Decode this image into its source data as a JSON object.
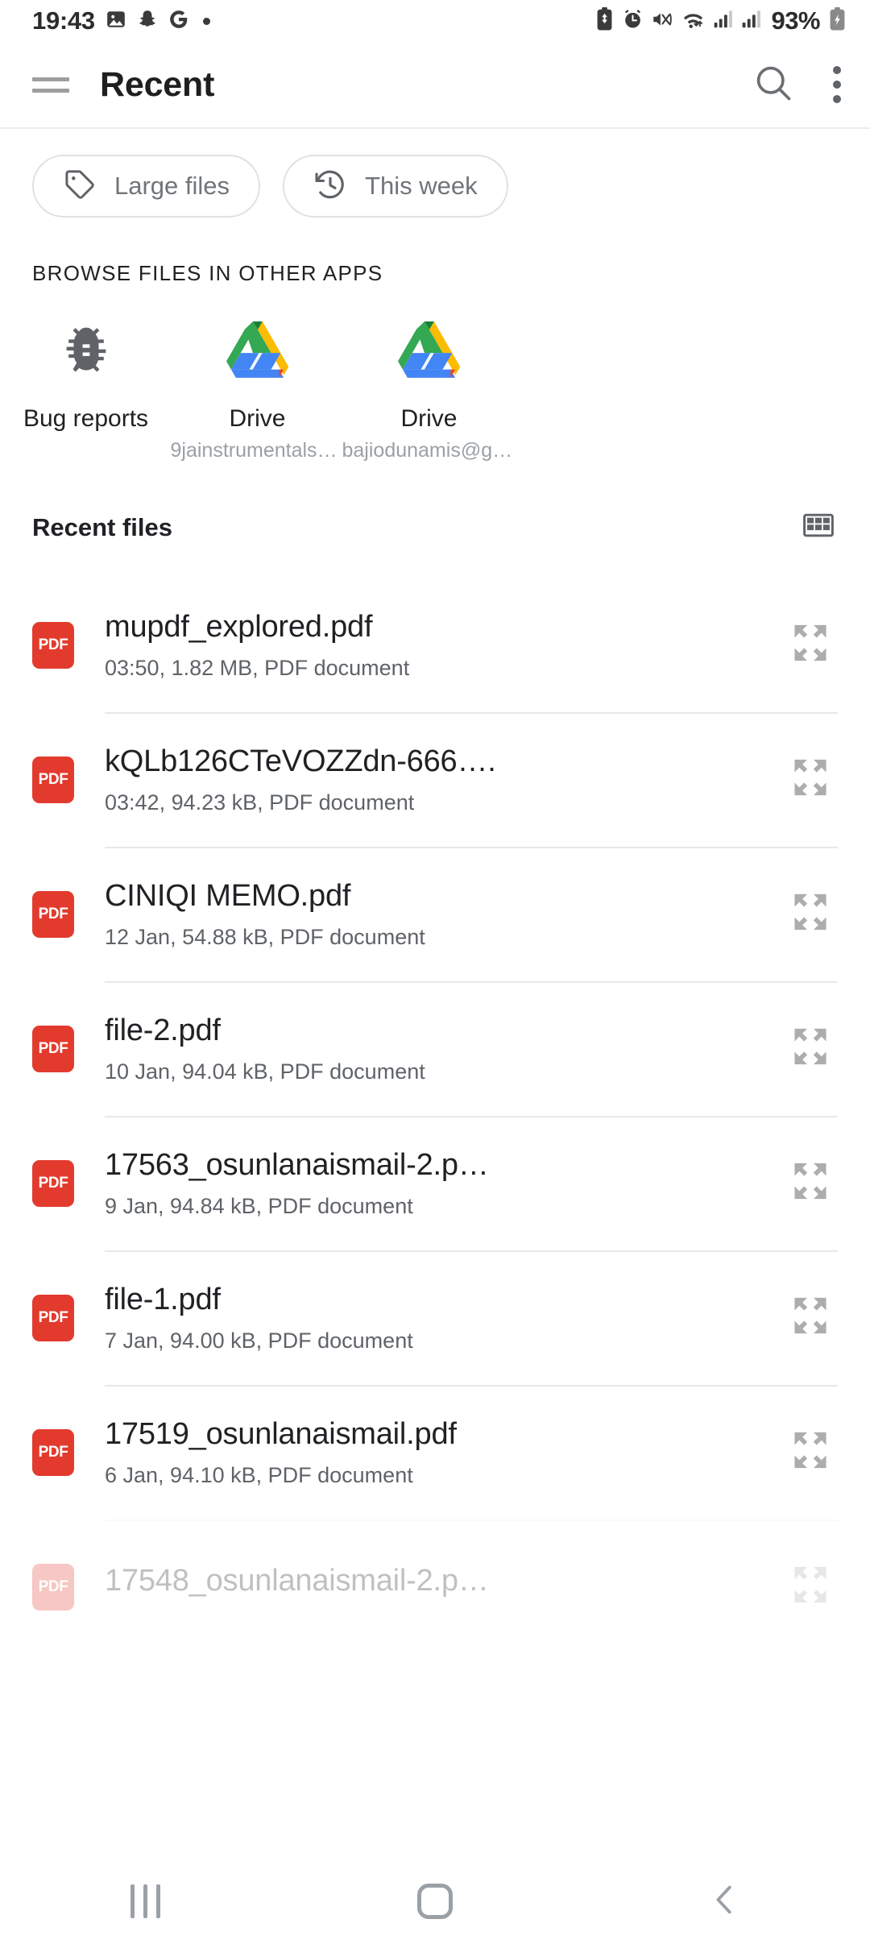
{
  "status_bar": {
    "time": "19:43",
    "battery_percent": "93%",
    "left_icons": [
      "photos-icon",
      "snapchat-icon",
      "google-icon",
      "dot-indicator-icon"
    ],
    "right_icons": [
      "battery-saver-icon",
      "alarm-icon",
      "mute-vibrate-icon",
      "wifi-icon",
      "signal-sim1-icon",
      "signal-sim2-icon",
      "battery-charging-icon"
    ]
  },
  "app_bar": {
    "title": "Recent",
    "menu_icon": "hamburger-menu-icon",
    "search_icon": "search-icon",
    "overflow_icon": "kebab-menu-icon"
  },
  "chips": [
    {
      "label": "Large files",
      "icon": "tag-icon"
    },
    {
      "label": "This week",
      "icon": "history-clock-icon"
    }
  ],
  "browse_section": {
    "heading": "BROWSE FILES IN OTHER APPS",
    "apps": [
      {
        "name": "Bug reports",
        "subtitle": "",
        "icon": "bug-icon"
      },
      {
        "name": "Drive",
        "subtitle": "9jainstrumentals@…",
        "icon": "google-drive-icon"
      },
      {
        "name": "Drive",
        "subtitle": "bajiodunamis@gm…",
        "icon": "google-drive-icon"
      }
    ]
  },
  "recent_files": {
    "heading": "Recent files",
    "view_toggle_icon": "grid-view-icon",
    "row_action_icon": "expand-arrows-icon",
    "file_type_badge": "PDF",
    "items": [
      {
        "name": "mupdf_explored.pdf",
        "meta": "03:50, 1.82 MB, PDF document"
      },
      {
        "name": "kQLb126CTeVOZZdn-666….",
        "meta": "03:42, 94.23 kB, PDF document"
      },
      {
        "name": "CINIQI MEMO.pdf",
        "meta": "12 Jan, 54.88 kB, PDF document"
      },
      {
        "name": "file-2.pdf",
        "meta": "10 Jan, 94.04 kB, PDF document"
      },
      {
        "name": "17563_osunlanaismail-2.p…",
        "meta": "9 Jan, 94.84 kB, PDF document"
      },
      {
        "name": "file-1.pdf",
        "meta": "7 Jan, 94.00 kB, PDF document"
      },
      {
        "name": "17519_osunlanaismail.pdf",
        "meta": "6 Jan, 94.10 kB, PDF document"
      },
      {
        "name": "17548_osunlanaismail-2.p…",
        "meta": ""
      }
    ]
  },
  "nav_bar": {
    "recents_label": "recents-button",
    "home_label": "home-button",
    "back_label": "back-button"
  },
  "colors": {
    "pdf_red": "#e23b2e",
    "text_primary": "#202124",
    "text_secondary": "#5f6368",
    "text_muted": "#9aa0a6",
    "drive_blue": "#1a73e8",
    "drive_green": "#34a853",
    "drive_yellow": "#fbbc04"
  }
}
